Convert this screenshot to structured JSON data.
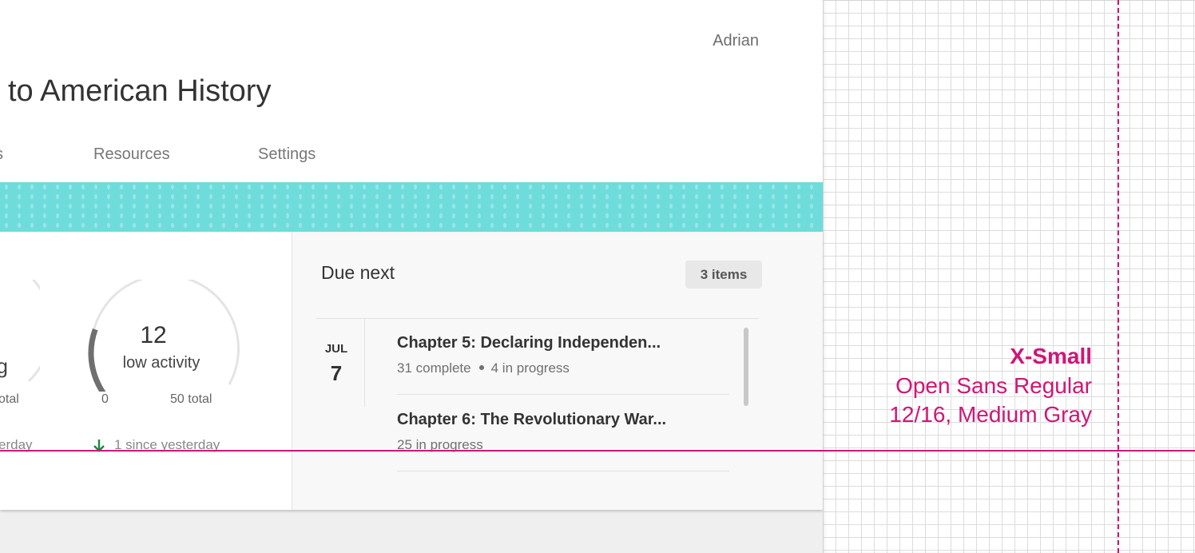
{
  "header": {
    "user_name": "Adrian",
    "course_title": "to American History",
    "tabs": [
      {
        "label": "s"
      },
      {
        "label": "Resources"
      },
      {
        "label": "Settings"
      }
    ]
  },
  "colors": {
    "banner": "#6fdcdc",
    "annotation": "#cf1677",
    "gauge_arc": "#6f6f6f",
    "down_arrow": "#1a8a3a"
  },
  "stats": {
    "partial_gauge": {
      "label_fragment": "g",
      "max_fragment": "otal",
      "since_fragment": "erday"
    },
    "low_activity": {
      "value": "12",
      "label": "low activity",
      "min_label": "0",
      "max_label": "50 total",
      "since_text": "1 since yesterday",
      "fraction": 0.24
    }
  },
  "due_next": {
    "title": "Due next",
    "badge": "3 items",
    "date": {
      "month": "JUL",
      "day": "7"
    },
    "items": [
      {
        "title": "Chapter 5: Declaring Independen...",
        "complete": "31 complete",
        "in_progress": "4 in progress"
      },
      {
        "title": "Chapter 6: The Revolutionary War...",
        "in_progress": "25 in progress"
      }
    ]
  },
  "annotation": {
    "name": "X-Small",
    "font": "Open Sans Regular",
    "spec": "12/16, Medium Gray"
  }
}
